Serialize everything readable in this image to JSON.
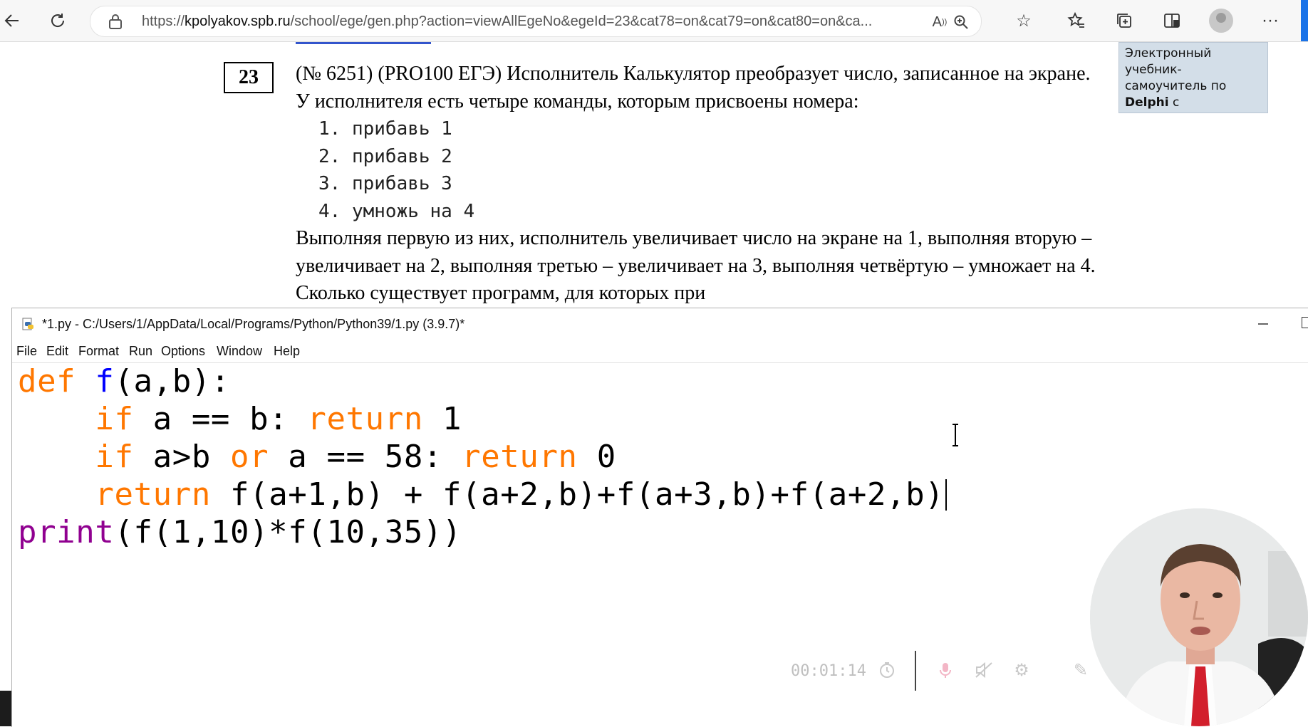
{
  "browser": {
    "url_prefix": "https://",
    "url_host": "kpolyakov.spb.ru",
    "url_rest": "/school/ege/gen.php?action=viewAllEgeNo&egeId=23&cat78=on&cat79=on&cat80=on&ca..."
  },
  "page": {
    "task_number": "23",
    "intro": "(№ 6251) (PRO100 ЕГЭ) Исполнитель Калькулятор преобразует число, записанное на экране. У исполнителя есть четыре команды, которым присвоены номера:",
    "commands": [
      "1. прибавь 1",
      "2. прибавь 2",
      "3. прибавь 3",
      "4. умножь на 4"
    ],
    "body": "Выполняя первую из них, исполнитель увеличивает число на экране на 1, выполняя вторую – увеличивает на 2, выполняя третью – увеличивает на 3, выполняя четвёртую – умножает на 4. Сколько существует программ, для которых при",
    "side_ad_text": "Электронный учебник-самоучитель по",
    "side_ad_bold": "Delphi",
    "side_ad_rest": "с практическими заданиями."
  },
  "editor": {
    "title": "*1.py - C:/Users/1/AppData/Local/Programs/Python/Python39/1.py (3.9.7)*",
    "menu": [
      "File",
      "Edit",
      "Format",
      "Run",
      "Options",
      "Window",
      "Help"
    ],
    "code": {
      "l1_kw": "def",
      "l1_fn": "f",
      "l1_rest": "(a,b):",
      "l2_indent": "    ",
      "l2_kw1": "if",
      "l2_mid": " a == b: ",
      "l2_kw2": "return",
      "l2_end": " 1",
      "l3_indent": "    ",
      "l3_kw1": "if",
      "l3_mid1": " a>b ",
      "l3_kw2": "or",
      "l3_mid2": " a == 58: ",
      "l3_kw3": "return",
      "l3_end": " 0",
      "l4_indent": "    ",
      "l4_kw": "return",
      "l4_rest": " f(a+1,b) + f(a+2,b)+f(a+3,b)+f(a+2,b)",
      "l5_bi": "print",
      "l5_rest": "(f(1,10)*f(10,35))"
    }
  },
  "recorder": {
    "time": "00:01:14"
  },
  "colors": {
    "keyword": "#ff7700",
    "function_name": "#0000ff",
    "builtin": "#900090",
    "ad_bg": "#d3dee8"
  }
}
